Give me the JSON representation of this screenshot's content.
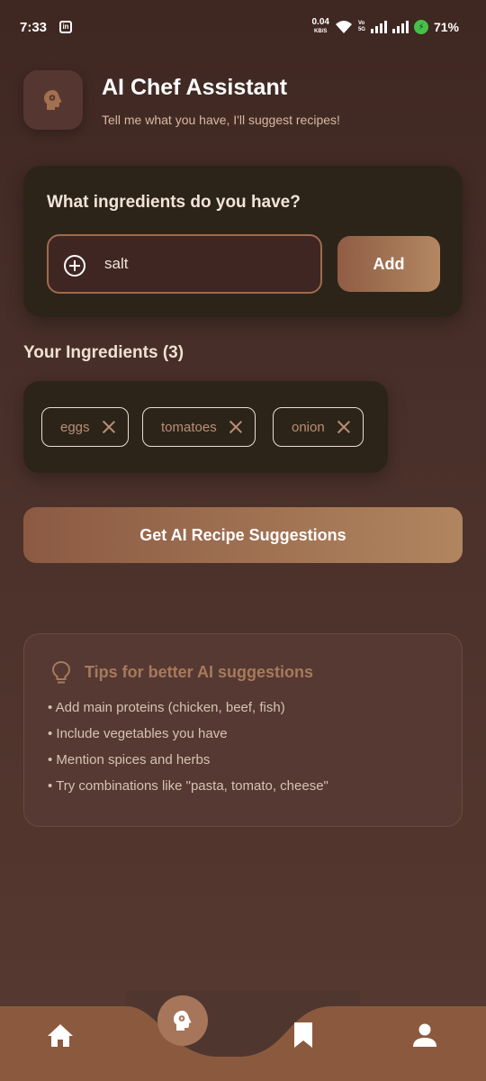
{
  "status_bar": {
    "time": "7:33",
    "net_speed": "0.04",
    "net_unit": "KB/S",
    "battery": "71%"
  },
  "header": {
    "title": "AI Chef Assistant",
    "subtitle": "Tell me what you have, I'll suggest recipes!"
  },
  "input_card": {
    "heading": "What ingredients do you have?",
    "input_value": "salt",
    "add_label": "Add"
  },
  "ingredients": {
    "heading": "Your Ingredients (3)",
    "items": [
      "eggs",
      "tomatoes",
      "onion"
    ]
  },
  "suggest_button": "Get AI Recipe Suggestions",
  "tips": {
    "title": "Tips for better AI suggestions",
    "items": [
      "• Add main proteins (chicken, beef, fish)",
      "• Include vegetables you have",
      "• Mention spices and herbs",
      "• Try combinations like \"pasta, tomato, cheese\""
    ]
  },
  "nav": {
    "items": [
      "home-icon",
      "ai-chef-icon",
      "bookmark-icon",
      "profile-icon"
    ],
    "active": "ai-chef-icon"
  },
  "colors": {
    "accent": "#8b5a3e",
    "card": "#2d2419",
    "tip_title": "#a77a5c"
  }
}
